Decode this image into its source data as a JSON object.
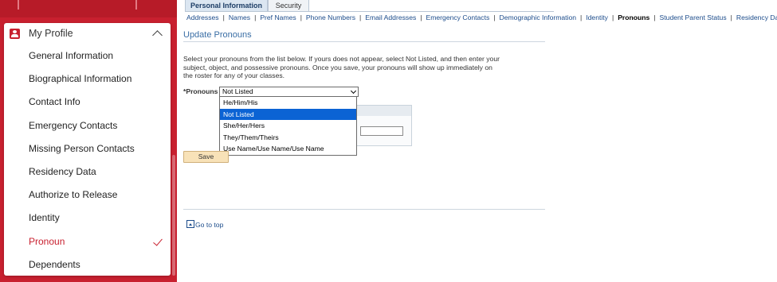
{
  "sidebar": {
    "profile_title": "My Profile",
    "items": [
      {
        "label": "General Information"
      },
      {
        "label": "Biographical Information"
      },
      {
        "label": "Contact Info"
      },
      {
        "label": "Emergency Contacts"
      },
      {
        "label": "Missing Person Contacts"
      },
      {
        "label": "Residency Data"
      },
      {
        "label": "Authorize to Release"
      },
      {
        "label": "Identity"
      },
      {
        "label": "Pronoun",
        "active": true
      },
      {
        "label": "Dependents"
      }
    ]
  },
  "tabs": [
    {
      "label": "Personal Information",
      "selected": true
    },
    {
      "label": "Security"
    }
  ],
  "subnav": [
    "Addresses",
    "Names",
    "Pref Names",
    "Phone Numbers",
    "Email Addresses",
    "Emergency Contacts",
    "Demographic Information",
    "Identity",
    "Pronouns",
    "Student Parent Status",
    "Residency Data"
  ],
  "subnav_current": "Pronouns",
  "page": {
    "title": "Update Pronouns",
    "instructions_line1": "Select your pronouns from the list below. If yours does not appear, select Not Listed, and then enter your",
    "instructions_line2": "subject, object, and possessive pronouns. Once you save, your pronouns will show up immediately on",
    "instructions_line3": "the roster for any of your classes.",
    "pronouns_label": "*Pronouns",
    "pronouns_value": "Not Listed",
    "options": [
      "He/Him/His",
      "Not Listed",
      "She/Her/Hers",
      "They/Them/Theirs",
      "Use Name/Use Name/Use Name"
    ],
    "selected_option": "Not Listed",
    "save_label": "Save",
    "go_top_label": "Go to top"
  },
  "colors": {
    "brand_red": "#c8202f",
    "link_blue": "#1c4c8b",
    "highlight": "#0b63d4"
  }
}
